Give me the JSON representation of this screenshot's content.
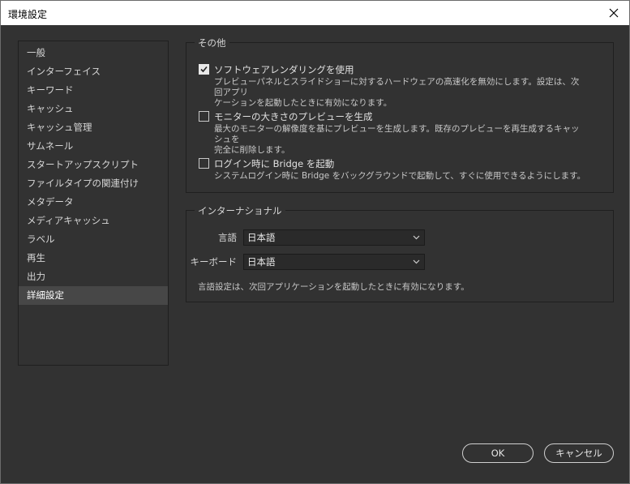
{
  "window": {
    "title": "環境設定"
  },
  "sidebar": {
    "items": [
      {
        "label": "一般"
      },
      {
        "label": "インターフェイス"
      },
      {
        "label": "キーワード"
      },
      {
        "label": "キャッシュ"
      },
      {
        "label": "キャッシュ管理"
      },
      {
        "label": "サムネール"
      },
      {
        "label": "スタートアップスクリプト"
      },
      {
        "label": "ファイルタイプの関連付け"
      },
      {
        "label": "メタデータ"
      },
      {
        "label": "メディアキャッシュ"
      },
      {
        "label": "ラベル"
      },
      {
        "label": "再生"
      },
      {
        "label": "出力"
      },
      {
        "label": "詳細設定"
      }
    ],
    "selected_index": 13
  },
  "other": {
    "title": "その他",
    "software_rendering": {
      "label": "ソフトウェアレンダリングを使用",
      "checked": true,
      "desc_line1": "プレビューパネルとスライドショーに対するハードウェアの高速化を無効にします。設定は、次回アプリ",
      "desc_line2": "ケーションを起動したときに有効になります。"
    },
    "monitor_preview": {
      "label": "モニターの大きさのプレビューを生成",
      "checked": false,
      "desc_line1": "最大のモニターの解像度を基にプレビューを生成します。既存のプレビューを再生成するキャッシュを",
      "desc_line2": "完全に削除します。"
    },
    "bridge_login": {
      "label": "ログイン時に Bridge を起動",
      "checked": false,
      "desc_line1": "システムログイン時に Bridge をバックグラウンドで起動して、すぐに使用できるようにします。"
    }
  },
  "international": {
    "title": "インターナショナル",
    "language_label": "言語",
    "language_value": "日本語",
    "keyboard_label": "キーボード",
    "keyboard_value": "日本語",
    "note": "言語設定は、次回アプリケーションを起動したときに有効になります。"
  },
  "buttons": {
    "ok": "OK",
    "cancel": "キャンセル"
  }
}
